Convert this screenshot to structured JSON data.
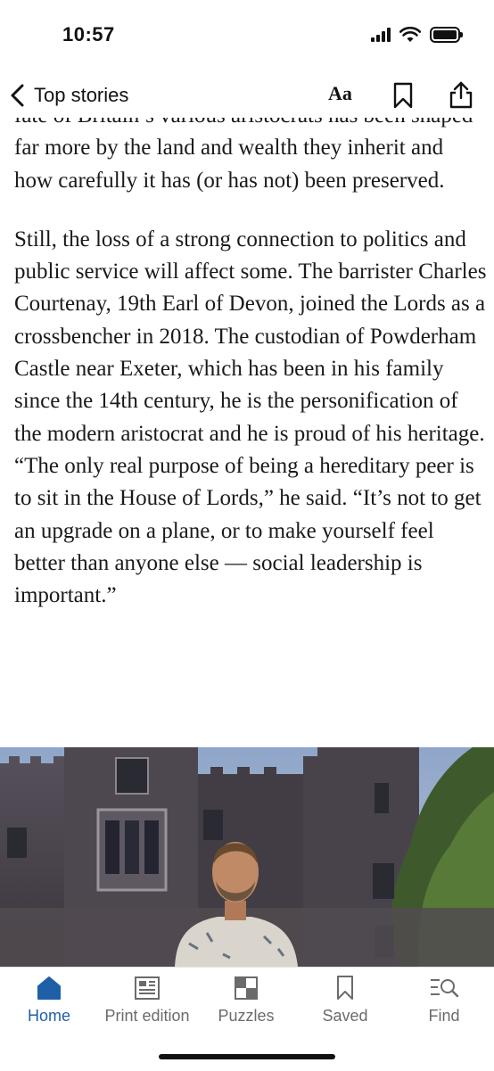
{
  "status_bar": {
    "time": "10:57"
  },
  "nav": {
    "back_label": "Top stories",
    "text_size_label": "Aa"
  },
  "article": {
    "paragraphs": [
      "fate of Britain’s various aristocrats has been shaped far more by the land and wealth they inherit and how carefully it has (or has not) been preserved.",
      "Still, the loss of a strong connection to politics and public service will affect some. The barrister Charles Courtenay, 19th Earl of Devon, joined the Lords as a crossbencher in 2018. The custodian of Powderham Castle near Exeter, which has been in his family since the 14th century, he is the personification of the modern aristocrat and he is proud of his heritage. “The only real purpose of being a hereditary peer is to sit in the House of Lords,” he said. “It’s not to get an upgrade on a plane, or to make yourself feel better than anyone else — social leadership is important.”"
    ]
  },
  "tabs": [
    {
      "label": "Home",
      "icon": "home-icon",
      "active": true
    },
    {
      "label": "Print edition",
      "icon": "newspaper-icon",
      "active": false
    },
    {
      "label": "Puzzles",
      "icon": "puzzle-grid-icon",
      "active": false
    },
    {
      "label": "Saved",
      "icon": "bookmark-icon",
      "active": false
    },
    {
      "label": "Find",
      "icon": "search-list-icon",
      "active": false
    }
  ],
  "colors": {
    "accent": "#1f5fa8",
    "inactive": "#6b6b6b",
    "text": "#1a1a1a"
  }
}
